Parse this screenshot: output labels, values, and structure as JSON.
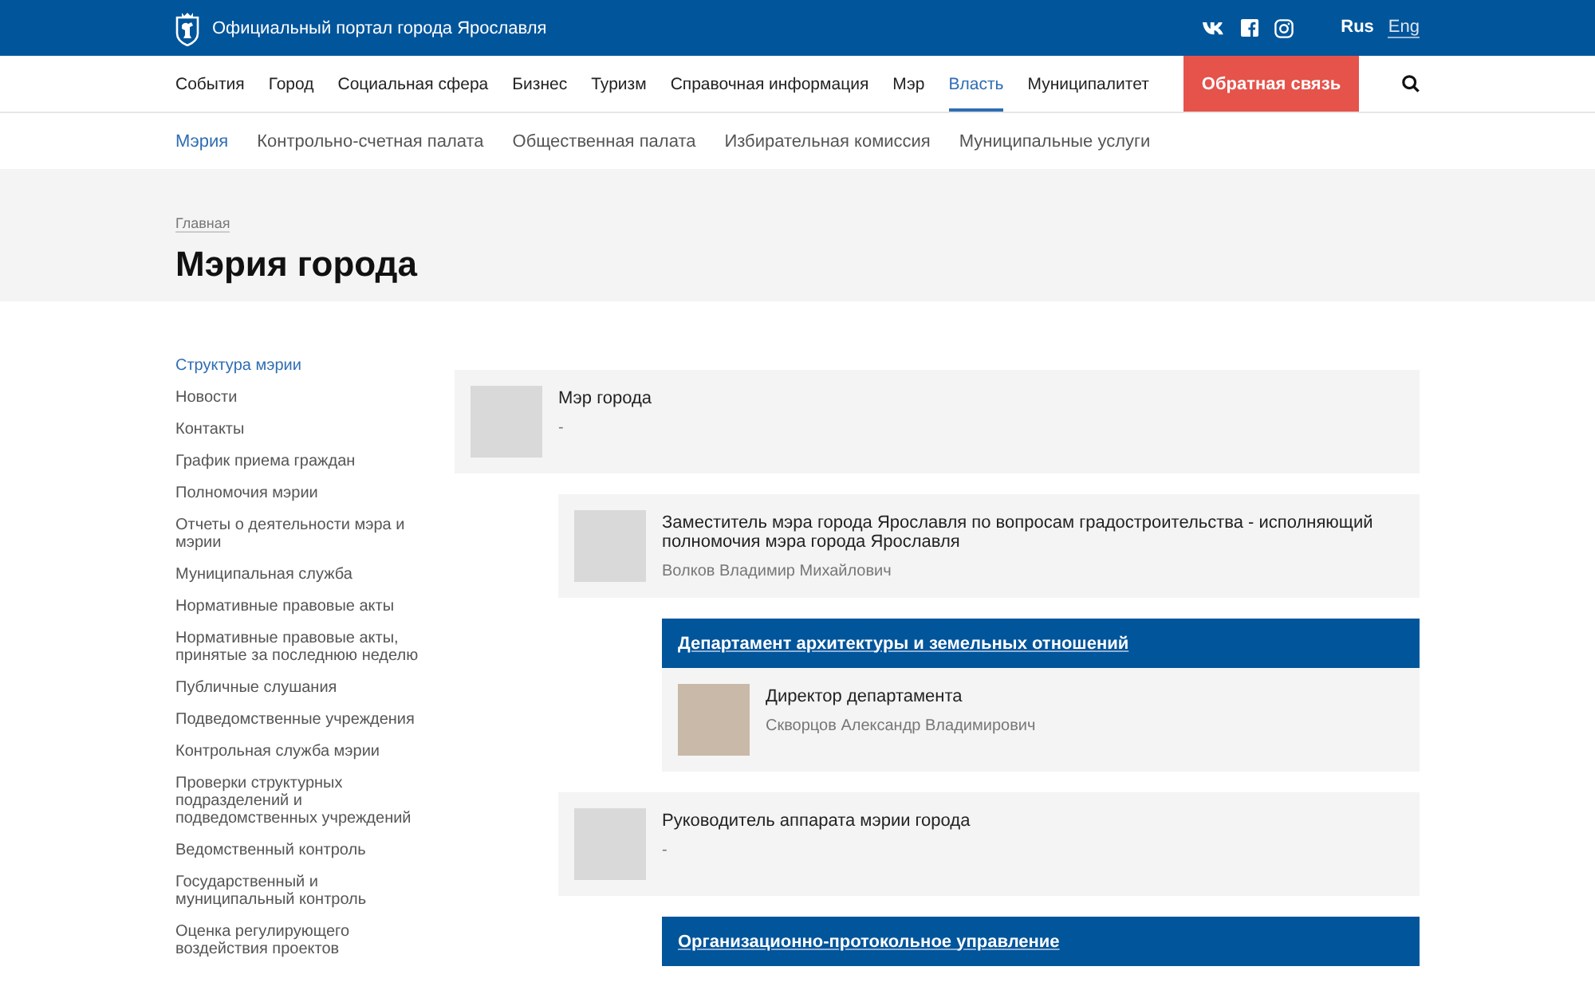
{
  "header": {
    "portal_title": "Официальный портал города Ярославля",
    "languages": [
      {
        "label": "Rus",
        "selected": true
      },
      {
        "label": "Eng",
        "selected": false
      }
    ]
  },
  "nav": {
    "items": [
      {
        "label": "События",
        "selected": false
      },
      {
        "label": "Город",
        "selected": false
      },
      {
        "label": "Социальная сфера",
        "selected": false
      },
      {
        "label": "Бизнес",
        "selected": false
      },
      {
        "label": "Туризм",
        "selected": false
      },
      {
        "label": "Справочная информация",
        "selected": false
      },
      {
        "label": "Мэр",
        "selected": false
      },
      {
        "label": "Власть",
        "selected": true
      },
      {
        "label": "Муниципалитет",
        "selected": false
      }
    ],
    "feedback_button": "Обратная связь"
  },
  "subnav": {
    "items": [
      {
        "label": "Мэрия",
        "selected": true
      },
      {
        "label": "Контрольно-счетная палата",
        "selected": false
      },
      {
        "label": "Общественная палата",
        "selected": false
      },
      {
        "label": "Избирательная комиссия",
        "selected": false
      },
      {
        "label": "Муниципальные услуги",
        "selected": false
      }
    ]
  },
  "hero": {
    "breadcrumb": "Главная",
    "title": "Мэрия города"
  },
  "sidebar": {
    "items": [
      {
        "label": "Структура мэрии",
        "selected": true
      },
      {
        "label": "Новости",
        "selected": false
      },
      {
        "label": "Контакты",
        "selected": false
      },
      {
        "label": "График приема граждан",
        "selected": false
      },
      {
        "label": "Полномочия мэрии",
        "selected": false
      },
      {
        "label": "Отчеты о деятельности мэра и мэрии",
        "selected": false
      },
      {
        "label": "Муниципальная служба",
        "selected": false
      },
      {
        "label": "Нормативные правовые акты",
        "selected": false
      },
      {
        "label": "Нормативные правовые акты, принятые за последнюю неделю",
        "selected": false
      },
      {
        "label": "Публичные слушания",
        "selected": false
      },
      {
        "label": "Подведомственные учреждения",
        "selected": false
      },
      {
        "label": "Контрольная служба мэрии",
        "selected": false
      },
      {
        "label": "Проверки структурных подразделений и подведомственных учреждений",
        "selected": false
      },
      {
        "label": "Ведомственный контроль",
        "selected": false
      },
      {
        "label": "Государственный и муниципальный контроль",
        "selected": false
      },
      {
        "label": "Оценка регулирующего воздействия проектов",
        "selected": false
      }
    ]
  },
  "org_tree": [
    {
      "kind": "person",
      "title": "Мэр города",
      "name": "-",
      "photo": false,
      "children": [
        {
          "kind": "person",
          "title": "Заместитель мэра города Ярославля по вопросам градостроительства - исполняющий полномочия мэра города Ярославля",
          "name": "Волков Владимир Михайлович",
          "photo": false,
          "children": [
            {
              "kind": "department",
              "title": "Департамент архитектуры и земельных отношений",
              "staff": [
                {
                  "title": "Директор департамента",
                  "name": "Скворцов Александр Владимирович",
                  "photo": true
                }
              ]
            }
          ]
        },
        {
          "kind": "person",
          "title": "Руководитель аппарата мэрии города",
          "name": "-",
          "photo": false,
          "children": [
            {
              "kind": "department",
              "title": "Организационно-протокольное управление"
            }
          ]
        }
      ]
    }
  ]
}
